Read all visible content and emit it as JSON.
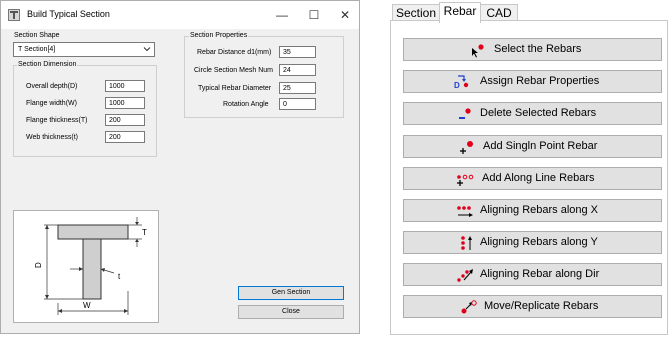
{
  "dialog": {
    "title": "Build Typical Section",
    "window_controls": {
      "minimize": "—",
      "maximize": "☐",
      "close": "✕"
    },
    "section_shape": {
      "label": "Section Shape",
      "selected": "T Section[4]"
    },
    "section_dimension": {
      "title": "Section Dimension",
      "fields": [
        {
          "label": "Overall depth(D)",
          "value": "1000"
        },
        {
          "label": "Flange width(W)",
          "value": "1000"
        },
        {
          "label": "Flange thickness(T)",
          "value": "200"
        },
        {
          "label": "Web thickness(t)",
          "value": "200"
        }
      ]
    },
    "section_properties": {
      "title": "Section Properties",
      "fields": [
        {
          "label": "Rebar Distance d1(mm)",
          "value": "35"
        },
        {
          "label": "Circle Section Mesh Num",
          "value": "24"
        },
        {
          "label": "Typical Rebar Diameter",
          "value": "25"
        },
        {
          "label": "Rotation Angle",
          "value": "0"
        }
      ]
    },
    "figure_labels": {
      "T": "T",
      "D": "D",
      "t": "t",
      "W": "W"
    },
    "buttons": {
      "gen_section": "Gen Section",
      "close": "Close"
    }
  },
  "panel": {
    "tabs": [
      {
        "label": "Section",
        "active": false
      },
      {
        "label": "Rebar",
        "active": true
      },
      {
        "label": "CAD",
        "active": false
      }
    ],
    "buttons": [
      {
        "label": "Select the Rebars",
        "icon": "select-rebars-icon"
      },
      {
        "label": "Assign Rebar Properties",
        "icon": "assign-properties-icon"
      },
      {
        "label": "Delete Selected Rebars",
        "icon": "delete-rebars-icon"
      },
      {
        "label": "Add Singln Point Rebar",
        "icon": "add-point-rebar-icon"
      },
      {
        "label": "Add Along Line Rebars",
        "icon": "add-line-rebars-icon"
      },
      {
        "label": "Aligning Rebars along X",
        "icon": "align-x-icon"
      },
      {
        "label": "Aligning Rebars along Y",
        "icon": "align-y-icon"
      },
      {
        "label": "Aligning Rebar along Dir",
        "icon": "align-dir-icon"
      },
      {
        "label": "Move/Replicate Rebars",
        "icon": "move-replicate-icon"
      }
    ],
    "colors": {
      "rebar_dot": "#e0001b",
      "icon_blue": "#1f3fd0"
    }
  }
}
